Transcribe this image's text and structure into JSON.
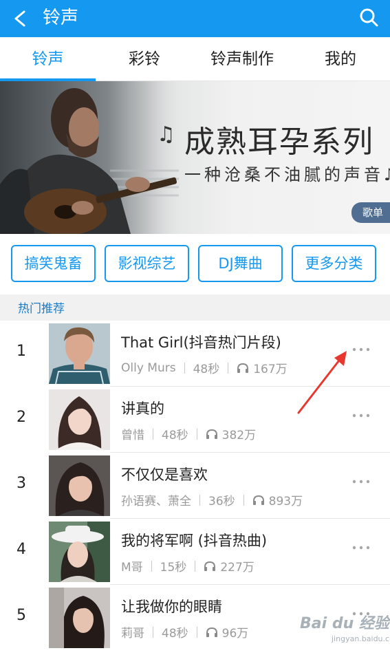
{
  "header": {
    "title": "铃声",
    "back_icon": "back-chevron-icon",
    "search_icon": "search-icon"
  },
  "tabs": [
    {
      "label": "铃声",
      "active": true
    },
    {
      "label": "彩铃",
      "active": false
    },
    {
      "label": "铃声制作",
      "active": false
    },
    {
      "label": "我的",
      "active": false
    }
  ],
  "banner": {
    "title": "成熟耳孕系列",
    "subtitle": "一种沧桑不油腻的声音",
    "note_glyph": "♫",
    "sub_note_glyph": "♪",
    "badge": "歌单"
  },
  "categories": [
    {
      "label": "搞笑鬼畜"
    },
    {
      "label": "影视综艺"
    },
    {
      "label": "DJ舞曲"
    },
    {
      "label": "更多分类"
    }
  ],
  "section": {
    "label": "热门推荐"
  },
  "songs": [
    {
      "rank": "1",
      "title": "That Girl(抖音热门片段)",
      "artist": "Olly Murs",
      "duration": "48秒",
      "plays": "167万"
    },
    {
      "rank": "2",
      "title": "讲真的",
      "artist": "曾惜",
      "duration": "48秒",
      "plays": "382万"
    },
    {
      "rank": "3",
      "title": "不仅仅是喜欢",
      "artist": "孙语赛、萧全",
      "duration": "36秒",
      "plays": "893万"
    },
    {
      "rank": "4",
      "title": "我的将军啊 (抖音热曲)",
      "artist": "M哥",
      "duration": "15秒",
      "plays": "227万"
    },
    {
      "rank": "5",
      "title": "让我做你的眼睛",
      "artist": "莉哥",
      "duration": "48秒",
      "plays": "96万"
    }
  ],
  "colors": {
    "accent": "#1598f0",
    "annotation": "#e8372f"
  },
  "watermark": {
    "main": "Bai du 经验",
    "sub": "jingyan.baidu.com"
  }
}
